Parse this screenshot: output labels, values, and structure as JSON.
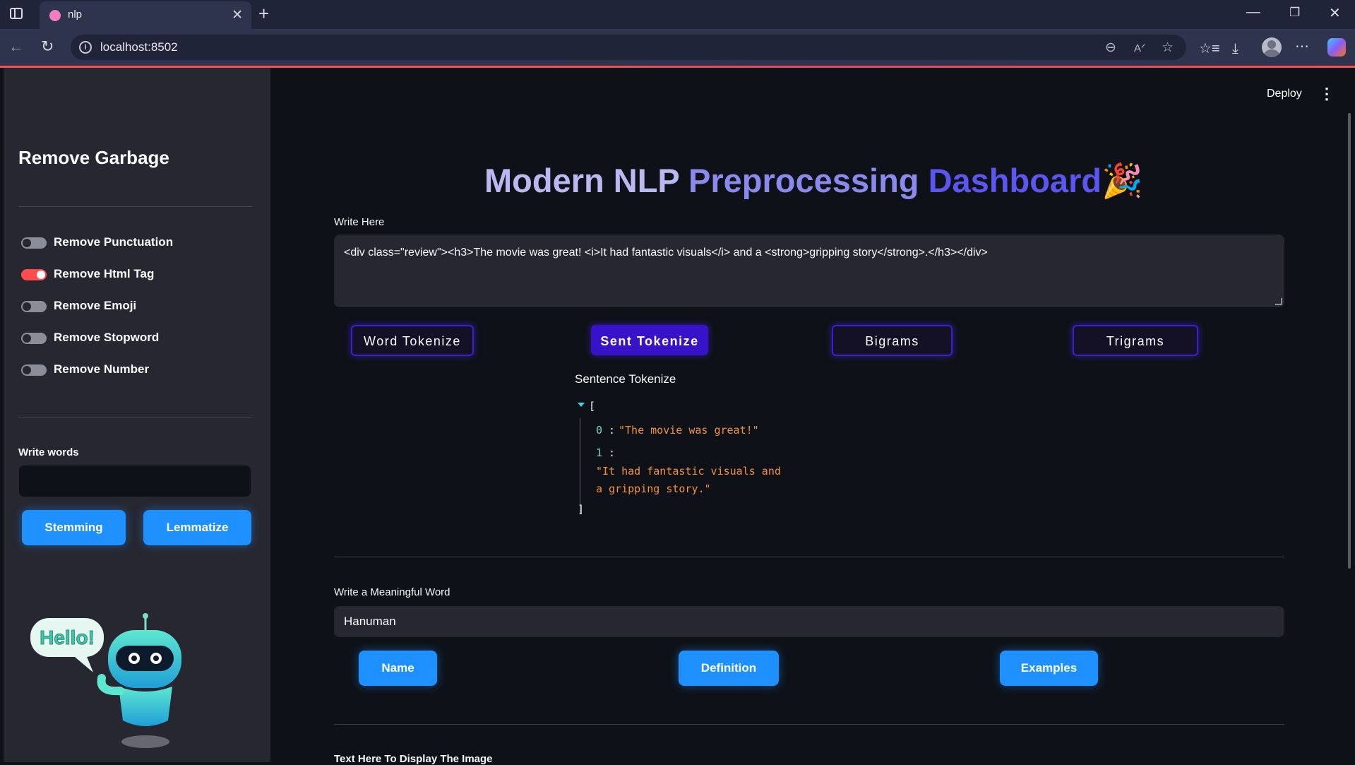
{
  "browser": {
    "tab_title": "nlp",
    "url": "localhost:8502"
  },
  "sidebar": {
    "title": "Remove Garbage",
    "toggles": [
      {
        "label": "Remove Punctuation",
        "on": false
      },
      {
        "label": "Remove Html Tag",
        "on": true
      },
      {
        "label": "Remove Emoji",
        "on": false
      },
      {
        "label": "Remove Stopword",
        "on": false
      },
      {
        "label": "Remove Number",
        "on": false
      }
    ],
    "words_label": "Write words",
    "words_value": "",
    "stemming_label": "Stemming",
    "lemmatize_label": "Lemmatize",
    "robot_bubble": "Hello!"
  },
  "header": {
    "deploy_label": "Deploy"
  },
  "main": {
    "title_part1": "Modern NLP ",
    "title_part2": "Preprocessing ",
    "title_part3": "Dashboard",
    "title_emoji": "🎉",
    "write_label": "Write Here",
    "write_value": "<div class=\"review\"><h3>The movie was great! <i>It had fantastic visuals</i> and a <strong>gripping story</strong>.</h3></div>",
    "token_buttons": [
      "Word Tokenize",
      "Sent Tokenize",
      "Bigrams",
      "Trigrams"
    ],
    "active_token_button": "Sent Tokenize",
    "result_heading": "Sentence Tokenize",
    "result": {
      "open_bracket": "[",
      "close_bracket": "]",
      "items": [
        {
          "index": "0",
          "value_line1": "\"The movie was great!\""
        },
        {
          "index": "1",
          "value_line1": "\"It had fantastic visuals and",
          "value_line2": "a gripping story.\""
        }
      ]
    },
    "meaning_label": "Write a Meaningful Word",
    "meaning_value": "Hanuman",
    "meaning_buttons": [
      "Name",
      "Definition",
      "Examples"
    ],
    "image_label": "Text Here To Display The Image"
  }
}
